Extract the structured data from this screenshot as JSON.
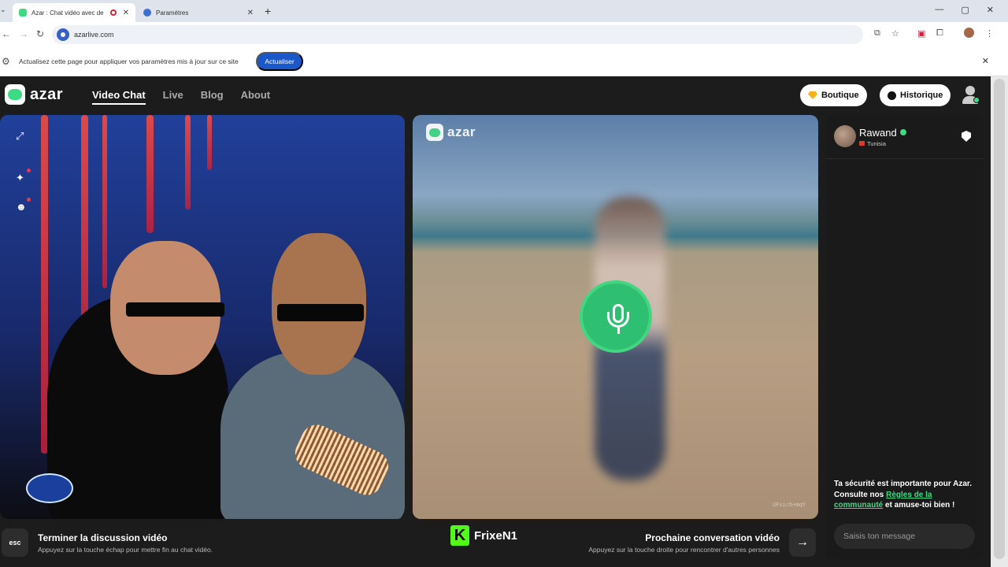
{
  "browser": {
    "tabs": [
      {
        "title": "Azar : Chat vidéo avec de n",
        "active": true
      },
      {
        "title": "Paramètres",
        "active": false
      }
    ],
    "url": "azarlive.com",
    "window_controls": [
      "—",
      "▢",
      "✕"
    ]
  },
  "infobar": {
    "message": "Actualisez cette page pour appliquer vos paramètres mis à jour sur ce site",
    "button": "Actualiser"
  },
  "app": {
    "logo_text": "azar",
    "nav": [
      "Video Chat",
      "Live",
      "Blog",
      "About"
    ],
    "active_nav": "Video Chat",
    "boutique": "Boutique",
    "historique": "Historique",
    "accent_color": "#3ddc84"
  },
  "video_right": {
    "logo_text": "azar",
    "watermark": "UFsich+mqY"
  },
  "chat": {
    "peer_name": "Rawand",
    "peer_country": "Tunisia",
    "safety_pre": "Ta sécurité est importante pour Azar. Consulte nos ",
    "safety_link": "Règles de la communauté",
    "safety_post": " et amuse-toi bien !",
    "input_placeholder": "Saisis ton message"
  },
  "bottom": {
    "esc": "esc",
    "end_title": "Terminer la discussion vidéo",
    "end_sub": "Appuyez sur la touche échap pour mettre fin au chat vidéo.",
    "brand_letter": "K",
    "brand_name": "FrixeN1",
    "next_title": "Prochaine conversation vidéo",
    "next_sub": "Appuyez sur la touche droite pour rencontrer d'autres personnes"
  }
}
